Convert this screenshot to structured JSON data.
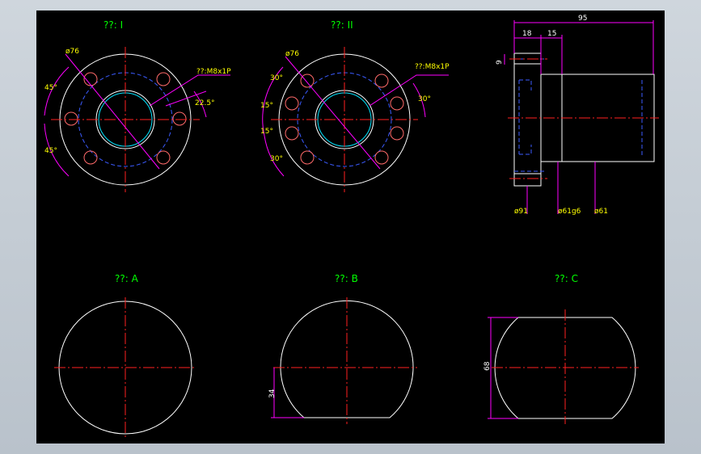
{
  "colors": {
    "background": "#000000",
    "outline": "#ffffff",
    "center_line": "#ff2020",
    "hidden_line": "#3b5bff",
    "dimension": "#ff00ff",
    "label": "#00ff00",
    "thread": "#00e5ff",
    "window_frame": "#c4ccd4"
  },
  "views": {
    "view1_title": "??: I",
    "view2_title": "??: II",
    "viewA_title": "??: A",
    "viewB_title": "??: B",
    "viewC_title": "??: C"
  },
  "view1": {
    "dia": "ø76",
    "thread": "??:M8x1P",
    "angle_top": "45°",
    "angle_bottom": "45°",
    "angle_right": "22.5°"
  },
  "view2": {
    "dia": "ø76",
    "thread": "??:M8x1P",
    "angle_a": "30°",
    "angle_b": "15°",
    "angle_c": "15°",
    "angle_d": "30°",
    "angle_right": "30°"
  },
  "side": {
    "len_total": "95",
    "len_a": "18",
    "len_b": "15",
    "height": "9",
    "dia_flange": "ø91",
    "dia_body": "ø61g6",
    "dia_bore": "ø61"
  },
  "viewB": {
    "dim": "34"
  },
  "viewC": {
    "dim": "68"
  }
}
